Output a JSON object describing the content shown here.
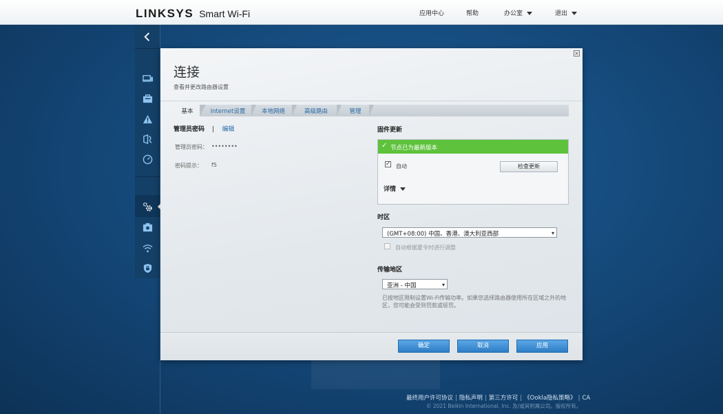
{
  "header": {
    "brand": "LINKSYS",
    "product": "Smart Wi-Fi",
    "nav": {
      "app_center": "应用中心",
      "help": "帮助",
      "account": "办公室",
      "logout": "退出"
    }
  },
  "sidebar": {
    "items": [
      {
        "icon": "back-chevron-icon"
      },
      {
        "icon": "devices-icon"
      },
      {
        "icon": "toolbox-icon"
      },
      {
        "icon": "alert-icon"
      },
      {
        "icon": "parental-controls-icon"
      },
      {
        "icon": "speed-test-icon"
      },
      {
        "icon": "settings-gear-icon",
        "active": true
      },
      {
        "icon": "external-storage-icon"
      },
      {
        "icon": "wifi-icon"
      },
      {
        "icon": "security-shield-icon"
      }
    ]
  },
  "modal": {
    "close_label": "×",
    "title": "连接",
    "subtitle": "查看并更改路由器设置",
    "tabs": [
      "基本",
      "Internet设置",
      "本地网络",
      "高级路由",
      "管理"
    ],
    "active_tab": "基本",
    "admin": {
      "heading": "管理员密码",
      "divider": "|",
      "edit_link": "编辑",
      "password_label": "管理员密码：",
      "password_value": "••••••••",
      "hint_label": "密码提示：",
      "hint_value": "f5"
    },
    "firmware": {
      "heading": "固件更新",
      "status": "节点已为最新版本",
      "status_color": "#5ec23c",
      "auto_label": "自动",
      "auto_checked": true,
      "check_button": "检查更新",
      "details_label": "详情"
    },
    "timezone": {
      "heading": "时区",
      "selected": "(GMT+08:00) 中国、香港、澳大利亚西部",
      "dst_label": "自动根据夏令时进行调整",
      "dst_checked": false
    },
    "region": {
      "heading": "传输地区",
      "selected": "亚洲 - 中国",
      "note": "已按地区限制设置Wi-Fi传输功率。如果您选择路由器使用所在区域之外的地区，您可能会受到罚款或惩罚。"
    },
    "buttons": {
      "ok": "确定",
      "cancel": "取消",
      "apply": "应用"
    }
  },
  "footer": {
    "links": [
      "最终用户许可协议",
      "隐私声明",
      "第三方许可",
      "《Ookla隐私策略》",
      "CA"
    ],
    "copyright": "© 2021 Belkin International, Inc. 及/或其附属公司。版权所有。"
  },
  "colors": {
    "accent_blue": "#2f7ec6",
    "link_blue": "#2b6aa6",
    "success_green": "#5ec23c",
    "background_blue": "#154a7c"
  }
}
